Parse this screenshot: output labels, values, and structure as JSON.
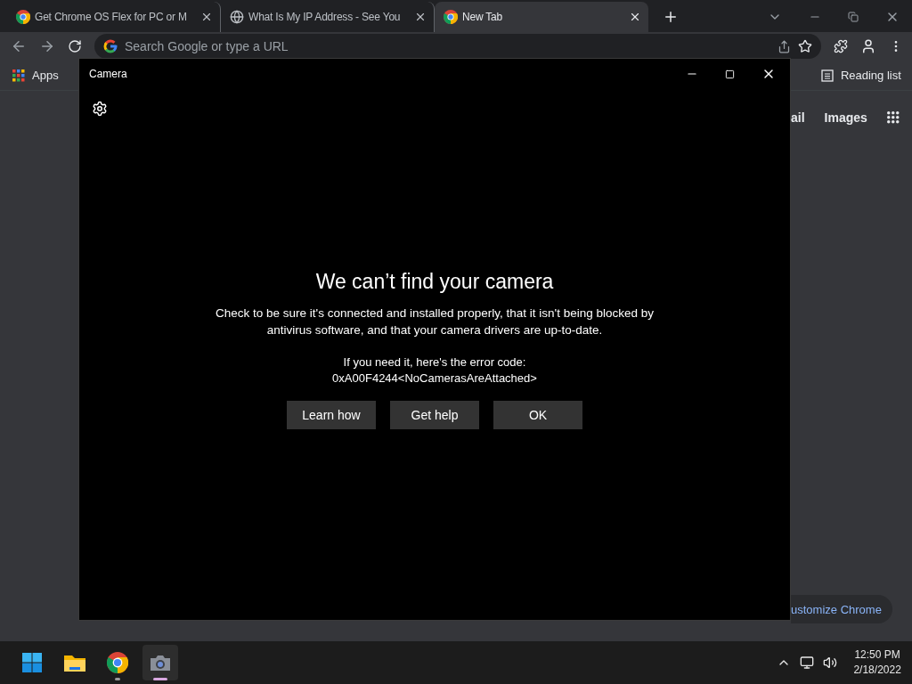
{
  "browser": {
    "tabs": [
      {
        "title": "Get Chrome OS Flex for PC or M",
        "kind": "chrome",
        "selected": false
      },
      {
        "title": "What Is My IP Address - See You",
        "kind": "globe",
        "selected": false
      },
      {
        "title": "New Tab",
        "kind": "chrome",
        "selected": true
      }
    ],
    "address_bar": {
      "placeholder": "Search Google or type a URL"
    },
    "bookmarks": {
      "apps": "Apps",
      "reading_list": "Reading list"
    },
    "page_links": [
      "ail",
      "Images"
    ],
    "customize_button": "ustomize Chrome"
  },
  "camera_window": {
    "title": "Camera",
    "heading": "We can’t find your camera",
    "message": "Check to be sure it's connected and installed properly, that it isn't being blocked by antivirus software, and that your camera drivers are up-to-date.",
    "error_intro": "If you need it, here's the error code:",
    "error_code": "0xA00F4244<NoCamerasAreAttached>",
    "buttons": [
      "Learn how",
      "Get help",
      "OK"
    ]
  },
  "taskbar": {
    "apps": [
      {
        "kind": "start",
        "running": false,
        "active": false
      },
      {
        "kind": "explorer",
        "running": false,
        "active": false
      },
      {
        "kind": "chrome",
        "running": true,
        "active": false
      },
      {
        "kind": "camera",
        "running": true,
        "active": true
      }
    ],
    "time": "12:50 PM",
    "date": "2/18/2022"
  }
}
